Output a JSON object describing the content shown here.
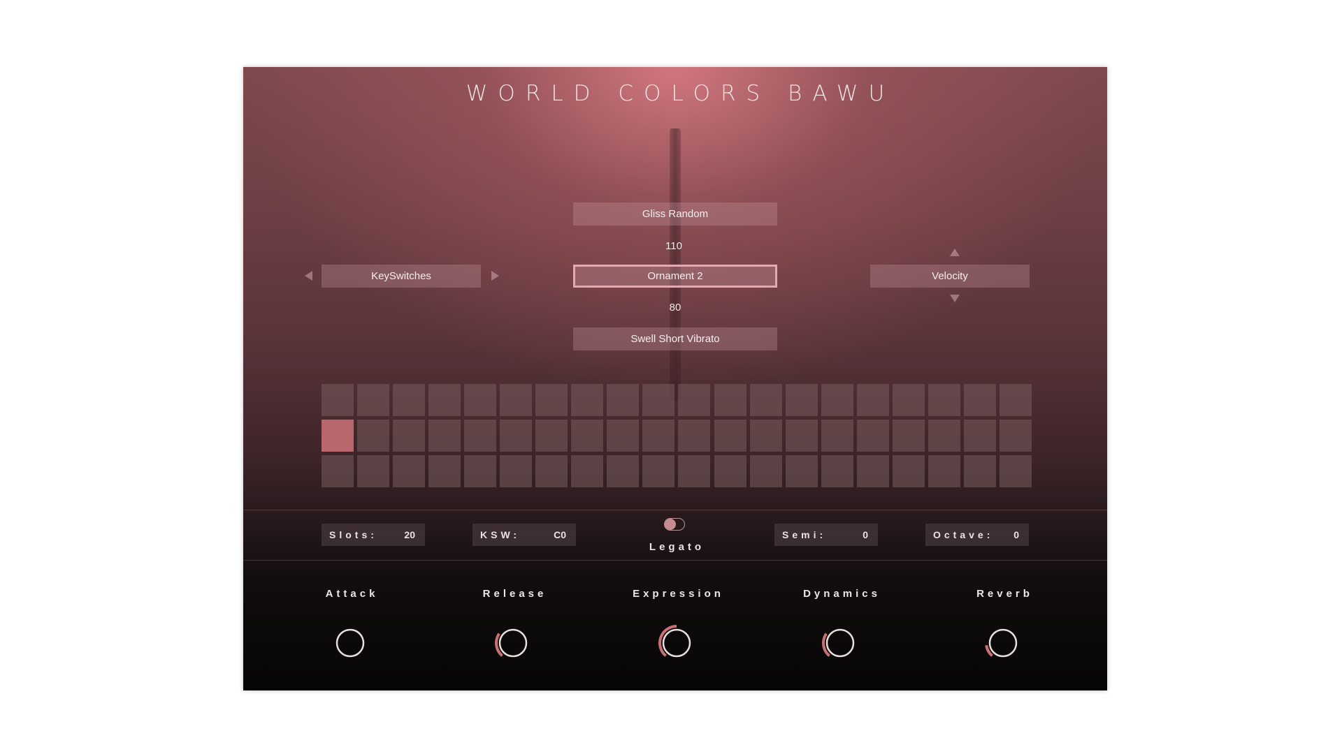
{
  "title": "WORLD COLORS BAWU",
  "articulation": {
    "upper": "Gliss Random",
    "upper_value": "110",
    "current": "Ornament 2",
    "lower_value": "80",
    "lower": "Swell Short Vibrato"
  },
  "left_selector": {
    "label": "KeySwitches"
  },
  "right_selector": {
    "label": "Velocity"
  },
  "slots_grid": {
    "columns": 20,
    "rows": 3,
    "active_cell": {
      "row": 2,
      "column": 1
    }
  },
  "settings": {
    "slots": {
      "label": "Slots:",
      "value": "20"
    },
    "ksw": {
      "label": "KSW:",
      "value": "C0"
    },
    "legato": {
      "label": "Legato",
      "enabled": false
    },
    "semi": {
      "label": "Semi:",
      "value": "0"
    },
    "octave": {
      "label": "Octave:",
      "value": "0"
    }
  },
  "knobs": [
    {
      "label": "Attack",
      "level": 0.0
    },
    {
      "label": "Release",
      "level": 0.3
    },
    {
      "label": "Expression",
      "level": 0.5
    },
    {
      "label": "Dynamics",
      "level": 0.3
    },
    {
      "label": "Reverb",
      "level": 0.15
    }
  ],
  "colors": {
    "accent": "#c96f76",
    "cell_active": "#b9666c",
    "knob_ring": "#e8dede"
  }
}
